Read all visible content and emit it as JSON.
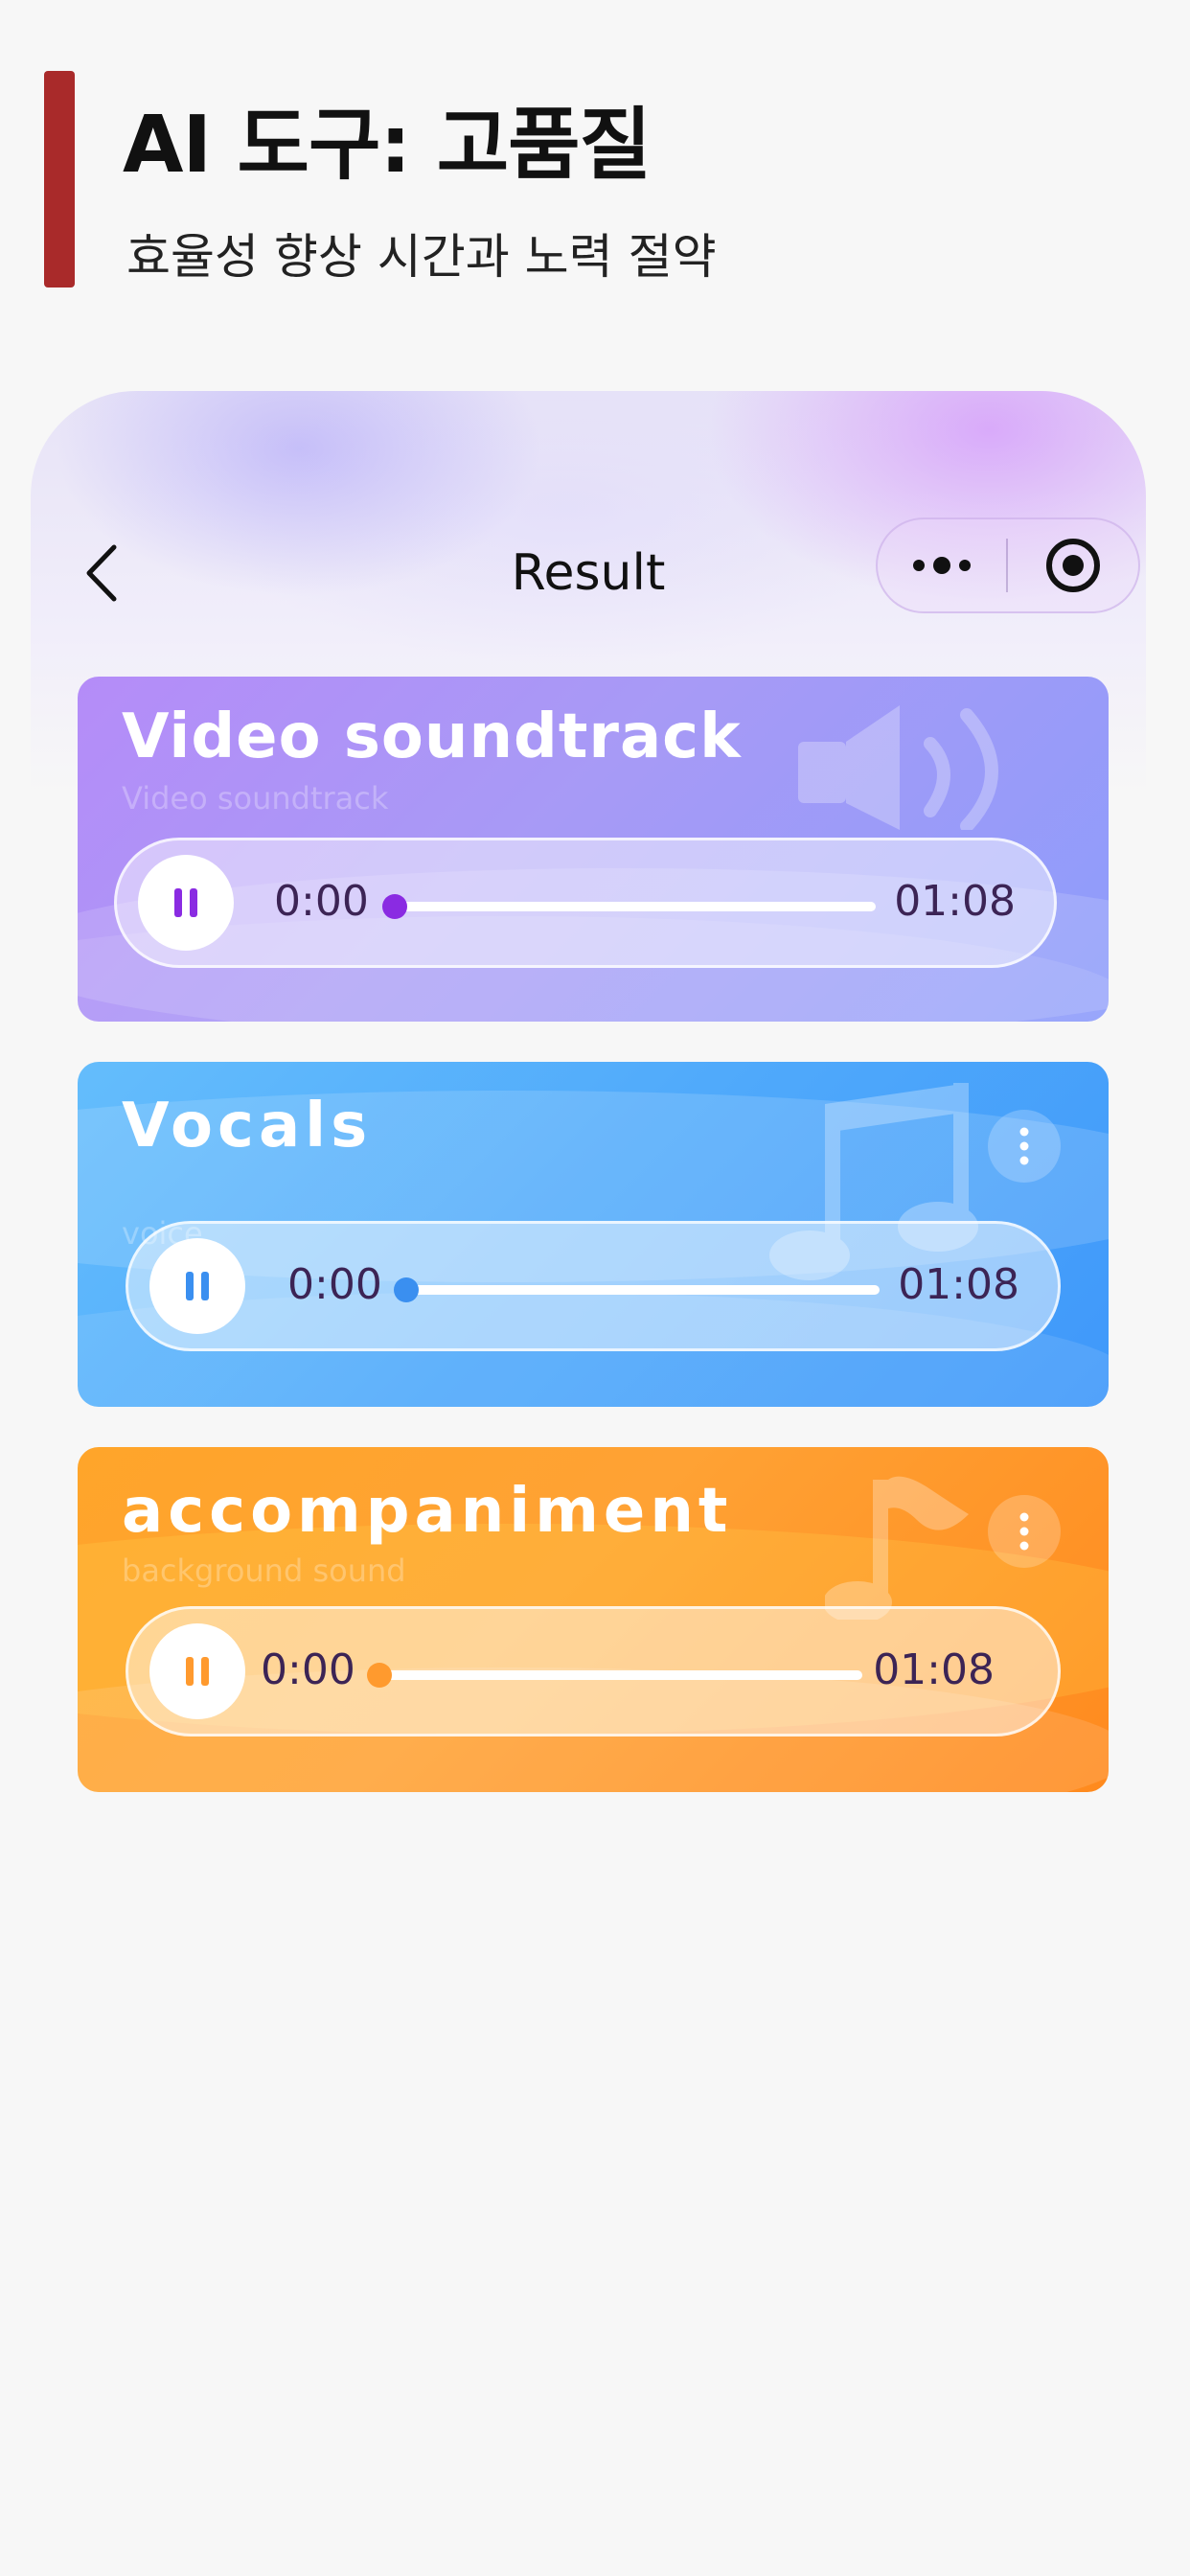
{
  "header": {
    "title": "AI 도구: 고품질",
    "subtitle": "효율성 향상 시간과 노력 절약"
  },
  "nav": {
    "title": "Result",
    "back_icon": "chevron-left-icon",
    "more_icon": "more-dots-icon",
    "target_icon": "record-target-icon"
  },
  "tracks": [
    {
      "title": "Video soundtrack",
      "subtitle": "Video soundtrack",
      "current_time": "0:00",
      "total_time": "01:08",
      "progress": 0,
      "accent": "#8a2be2",
      "deco_icon": "speaker-icon"
    },
    {
      "title": "Vocals",
      "subtitle": "voice",
      "current_time": "0:00",
      "total_time": "01:08",
      "progress": 0,
      "accent": "#3a8ff0",
      "deco_icon": "music-note-icon"
    },
    {
      "title": "accompaniment",
      "subtitle": "background sound",
      "current_time": "0:00",
      "total_time": "01:08",
      "progress": 0,
      "accent": "#ff9a2e",
      "deco_icon": "eighth-note-icon"
    }
  ],
  "colors": {
    "accent_bar": "#a92a2a",
    "card1": "#a79af6",
    "card2": "#4fa9fb",
    "card3": "#ffa234"
  }
}
